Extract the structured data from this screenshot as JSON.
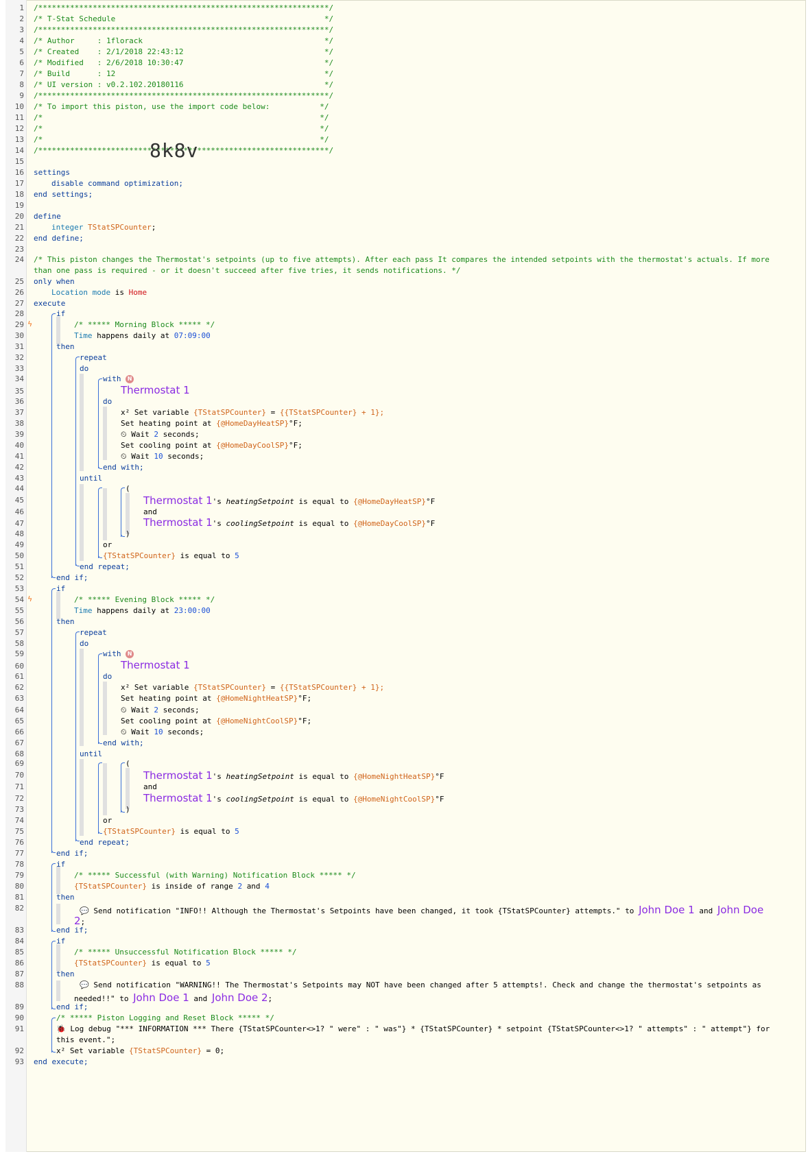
{
  "lines": [
    {
      "n": "1",
      "t": "/****************************************************************/"
    },
    {
      "n": "2",
      "t": "/* T-Stat Schedule                                              */"
    },
    {
      "n": "3",
      "t": "/****************************************************************/"
    },
    {
      "n": "4",
      "t": "/* Author     : 1florack                                        */"
    },
    {
      "n": "5",
      "t": "/* Created    : 2/1/2018 22:43:12                               */"
    },
    {
      "n": "6",
      "t": "/* Modified   : 2/6/2018 10:30:47                               */"
    },
    {
      "n": "7",
      "t": "/* Build      : 12                                              */"
    },
    {
      "n": "8",
      "t": "/* UI version : v0.2.102.20180116                               */"
    },
    {
      "n": "9",
      "t": "/****************************************************************/"
    },
    {
      "n": "10",
      "t": "/* To import this piston, use the import code below:           */"
    },
    {
      "n": "11",
      "t": "/*                                                             */"
    },
    {
      "n": "12",
      "t": "/*                                                             */"
    },
    {
      "n": "13",
      "t": "/*                                                             */"
    },
    {
      "n": "14",
      "t": "/****************************************************************/"
    }
  ],
  "import_code": "8k8v",
  "code": {
    "settings_kw": "settings",
    "disable_cmd": "disable command optimization;",
    "end_settings": "end settings;",
    "define_kw": "define",
    "integer_kw": "integer",
    "var_name": "TStatSPCounter",
    "semi": ";",
    "end_define": "end define;",
    "desc_comment_1": "/* This piston changes the Thermostat's setpoints (up to five attempts). After each pass It compares the intended setpoints with the thermostat's actuals. If more",
    "desc_comment_2": "than one pass is required - or it doesn't succeed after five tries, it sends notifications. */",
    "only_when": "only when",
    "location_mode": "Location mode",
    "is": "is",
    "home": "Home",
    "execute": "execute",
    "if": "if",
    "then": "then",
    "end_if": "end if;",
    "repeat": "repeat",
    "do": "do",
    "with": "with",
    "badge": "N",
    "device": "Thermostat 1",
    "end_with": "end with;",
    "until": "until",
    "open_paren": "(",
    "close_paren": ")",
    "and": "and",
    "or": "or",
    "end_repeat": "end repeat;",
    "morning_comment": "/* ***** Morning Block ***** */",
    "evening_comment": "/* ***** Evening Block ***** */",
    "time_kw": "Time",
    "happens_daily_at": "happens daily at",
    "morning_time": "07:09:00",
    "evening_time": "23:00:00",
    "set_var_icon": "x²",
    "set_variable": "Set variable",
    "counter_var": "{TStatSPCounter}",
    "counter_expr_eq": "=",
    "counter_expr": "{{TStatSPCounter} + 1};",
    "set_heating": "Set heating point at",
    "set_cooling": "Set cooling point at",
    "home_day_heat": "{@HomeDayHeatSP}",
    "home_day_cool": "{@HomeDayCoolSP}",
    "home_night_heat": "{@HomeNightHeatSP}",
    "home_night_cool": "{@HomeNightCoolSP}",
    "deg_f": "°F;",
    "deg_f_plain": "°F",
    "wait_icon": "⏲",
    "wait": "Wait",
    "wait_2": "2",
    "wait_10": "10",
    "seconds": "seconds;",
    "poss_s": "'s",
    "heating_sp": "heatingSetpoint",
    "cooling_sp": "coolingSetpoint",
    "is_equal_to": "is equal to",
    "five": "5",
    "success_comment": "/* ***** Successful (with Warning) Notification Block ***** */",
    "inside_range": "is inside of range",
    "range_lo": "2",
    "range_and": "and",
    "range_hi": "4",
    "send_icon": "💬",
    "send_notification": "Send notification",
    "info_msg": "\"INFO!! Although the Thermostat's Setpoints have been changed, it took {TStatSPCounter} attempts.\"",
    "to": "to",
    "john1": "John Doe 1",
    "john2": "John Doe",
    "john2b": "2",
    "john2full": "John Doe 2",
    "unsuccess_comment": "/* ***** Unsuccessful Notification Block ***** */",
    "warn_msg": "\"WARNING!! The Thermostat's Setpoints may NOT have been changed after 5 attempts!. Check and change the thermostat's setpoints as",
    "warn_msg_2": "needed!!\"",
    "logging_comment": "/* ***** Piston Logging and Reset Block ***** */",
    "log_icon": "🐞",
    "log_debug": "Log debug",
    "log_msg": "\"*** INFORMATION *** There {TStatSPCounter<>1? \" were\" : \" was\"} * {TStatSPCounter} * setpoint {TStatSPCounter<>1? \" attempts\" : \" attempt\"} for",
    "log_msg_2": "this event.\";",
    "reset_expr": "= 0;",
    "end_execute": "end execute;"
  },
  "line_numbers": [
    "1",
    "2",
    "3",
    "4",
    "5",
    "6",
    "7",
    "8",
    "9",
    "10",
    "11",
    "12",
    "13",
    "14",
    "15",
    "16",
    "17",
    "18",
    "19",
    "20",
    "21",
    "22",
    "23",
    "24",
    "25",
    "26",
    "27",
    "28",
    "29",
    "30",
    "31",
    "32",
    "33",
    "34",
    "35",
    "36",
    "37",
    "38",
    "39",
    "40",
    "41",
    "42",
    "43",
    "44",
    "45",
    "46",
    "47",
    "48",
    "49",
    "50",
    "51",
    "52",
    "53",
    "54",
    "55",
    "56",
    "57",
    "58",
    "59",
    "60",
    "61",
    "62",
    "63",
    "64",
    "65",
    "66",
    "67",
    "68",
    "69",
    "70",
    "71",
    "72",
    "73",
    "74",
    "75",
    "76",
    "77",
    "78",
    "79",
    "80",
    "81",
    "82",
    "83",
    "84",
    "85",
    "86",
    "87",
    "88",
    "89",
    "90",
    "91",
    "92",
    "93"
  ],
  "trigger_icon": "ϟ",
  "colors": {
    "comment": "#1c8a1c",
    "keyword": "#0a3d9c",
    "variable": "#d0641a",
    "number": "#1a4fd6",
    "device": "#8a2be2",
    "trigger": "#f0741f",
    "background": "#fefdf0"
  }
}
